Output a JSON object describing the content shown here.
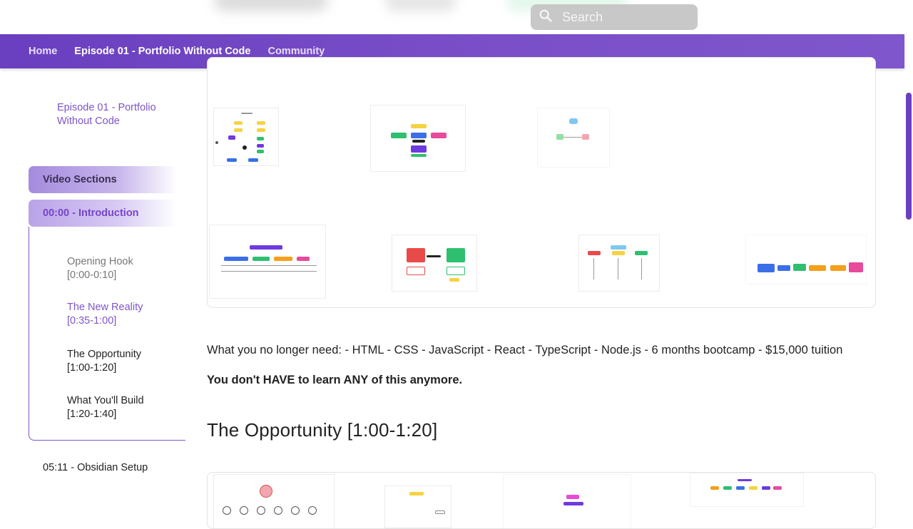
{
  "search": {
    "placeholder": "Search"
  },
  "nav": {
    "home": "Home",
    "episode": "Episode 01 - Portfolio Without Code",
    "community": "Community"
  },
  "sidebar": {
    "title": "Episode 01 - Portfolio Without Code",
    "video_sections": "Video Sections",
    "intro": "00:00 - Introduction",
    "items": [
      {
        "label": "Opening Hook [0:00-0:10]"
      },
      {
        "label": "The New Reality [0:35-1:00]"
      },
      {
        "label": "The Opportunity [1:00-1:20]"
      },
      {
        "label": "What You'll Build [1:20-1:40]"
      }
    ],
    "obsidian": "05:11 - Obsidian Setup"
  },
  "content": {
    "paragraph": "What you no longer need: - HTML - CSS - JavaScript - React - TypeScript - Node.js - 6 months bootcamp - $15,000 tuition",
    "bold": "You don't HAVE to learn ANY of this anymore.",
    "heading": "The Opportunity [1:00-1:20]"
  },
  "colors": {
    "accent": "#7e55cb",
    "nav_start": "#6a3fc0",
    "nav_end": "#7f56cc",
    "search_bg": "#c8c8c8"
  },
  "icons": {
    "search": "search-icon"
  }
}
